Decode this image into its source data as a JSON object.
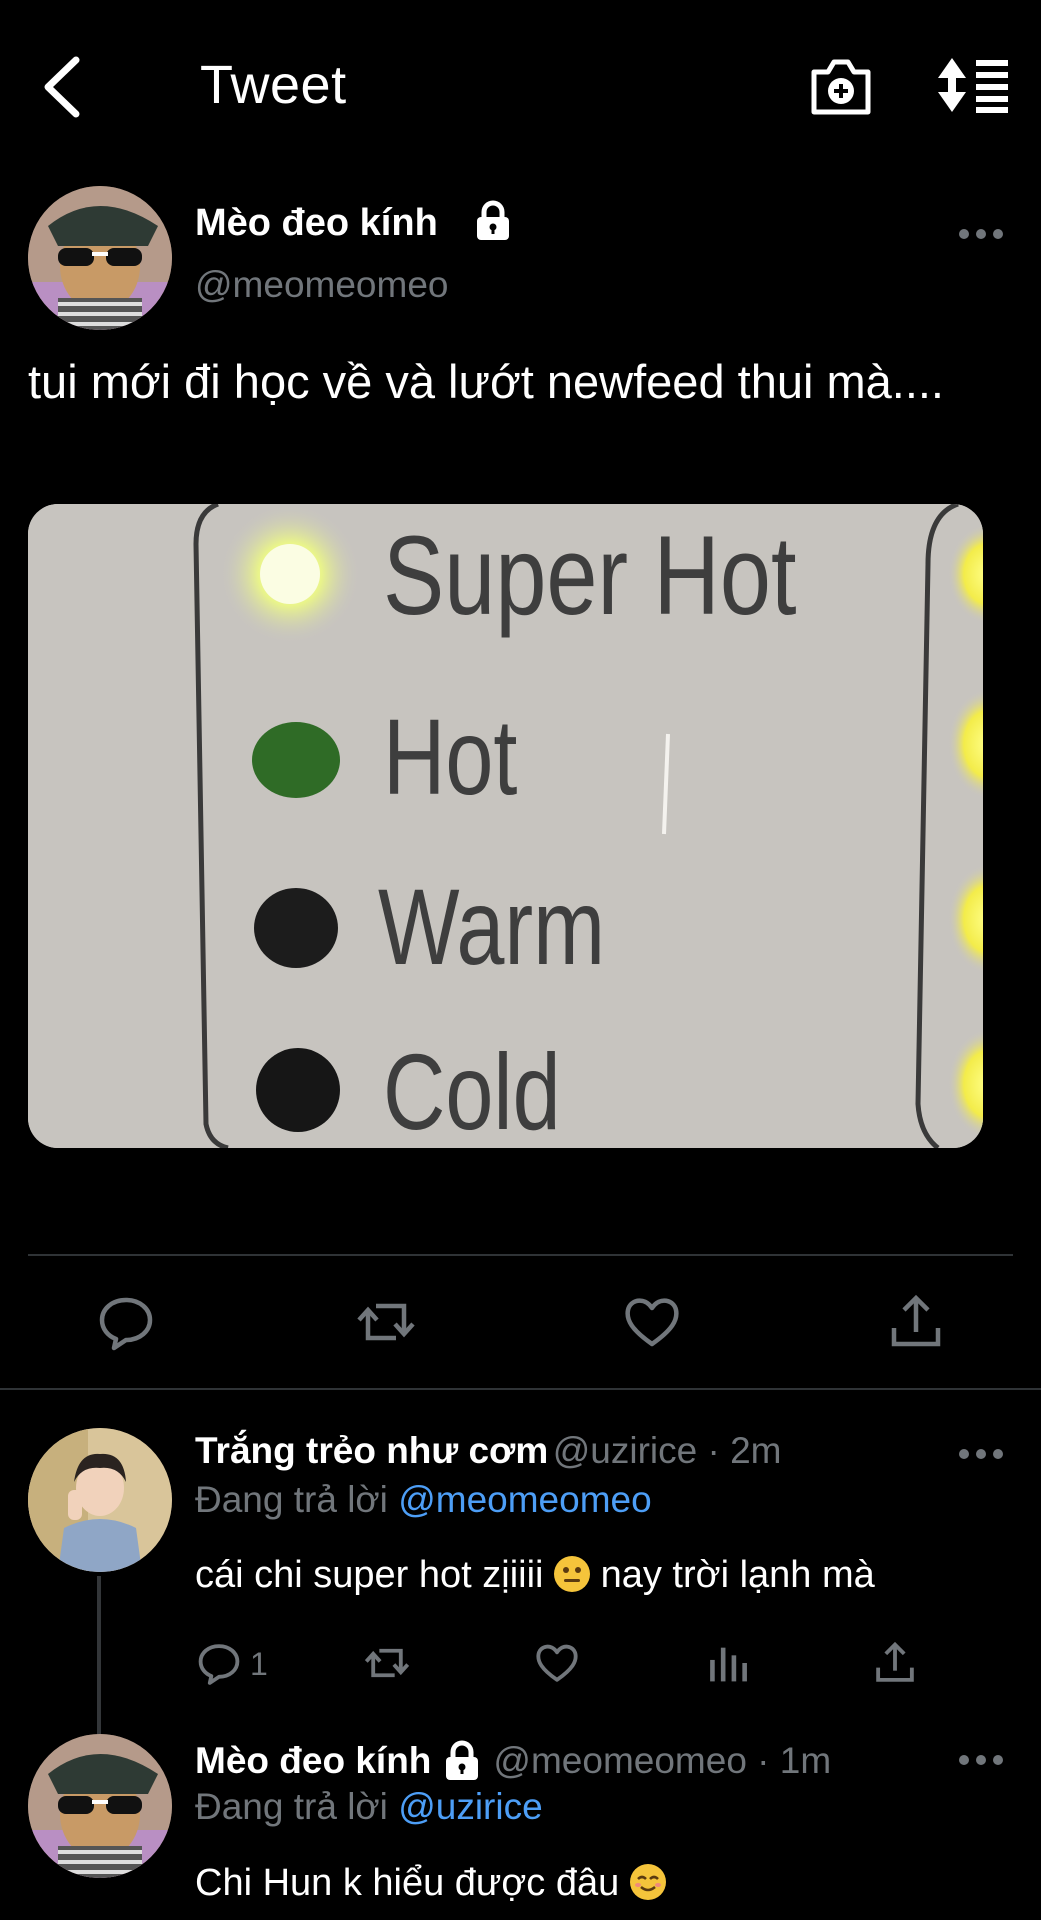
{
  "header": {
    "title": "Tweet"
  },
  "tweet": {
    "author_name": "Mèo đeo kính",
    "handle": "@meomeomeo",
    "text": "tui mới đi học về và lướt newfeed thui mà....",
    "media_labels": [
      "Super Hot",
      "Hot",
      "Warm",
      "Cold"
    ]
  },
  "replies": [
    {
      "name": "Trắng trẻo như cơm",
      "meta": "@uzirice · 2m",
      "replying_prefix": "Đang trả lời",
      "replying_to": "@meomeomeo",
      "text_before": "cái chi super hot zịiiii",
      "text_after": "nay trời lạnh mà",
      "reply_count": "1"
    },
    {
      "name": "Mèo đeo kính",
      "meta": "@meomeomeo · 1m",
      "replying_prefix": "Đang trả lời",
      "replying_to": "@uzirice",
      "text": "Chi Hun k hiểu được đâu"
    }
  ],
  "colors": {
    "background": "#000000",
    "muted": "#71767b",
    "link": "#4d9ef6",
    "divider": "#2f3336"
  }
}
